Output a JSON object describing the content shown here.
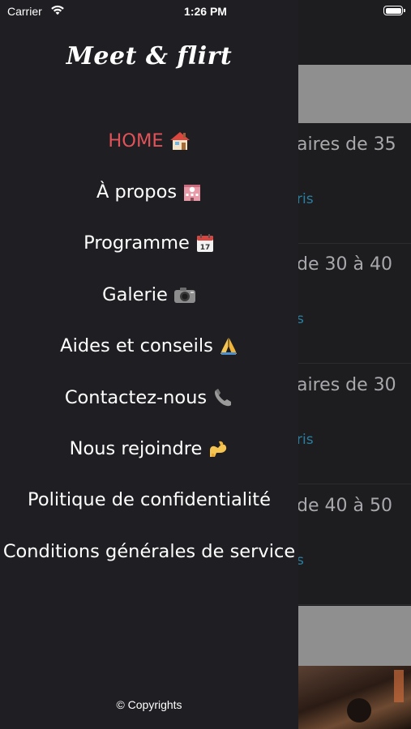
{
  "status_bar": {
    "carrier": "Carrier",
    "time": "1:26 PM"
  },
  "drawer": {
    "brand": "Meet & flirt",
    "menu": [
      {
        "label": "HOME",
        "icon": "house-icon",
        "active": true
      },
      {
        "label": "À propos",
        "icon": "hotel-icon",
        "active": false
      },
      {
        "label": "Programme",
        "icon": "calendar-icon",
        "active": false
      },
      {
        "label": "Galerie",
        "icon": "camera-icon",
        "active": false
      },
      {
        "label": "Aides et conseils",
        "icon": "folded-hands-icon",
        "active": false
      },
      {
        "label": "Contactez-nous",
        "icon": "phone-icon",
        "active": false
      },
      {
        "label": "Nous rejoindre",
        "icon": "flexed-biceps-icon",
        "active": false
      },
      {
        "label": "Politique de confidentialité",
        "icon": null,
        "active": false
      },
      {
        "label": "Conditions générales de service",
        "icon": null,
        "active": false
      }
    ],
    "copyright": "© Copyrights"
  },
  "background": {
    "cards": [
      {
        "title": "aires de 35",
        "link": "ris"
      },
      {
        "title": "de 30 à 40",
        "link": "s"
      },
      {
        "title": "aires de 30",
        "link": "ris"
      },
      {
        "title": "de 40 à 50",
        "link": "s"
      }
    ]
  },
  "colors": {
    "drawer_bg": "#1f1e23",
    "active_item": "#e05358",
    "link": "#2b7fa0"
  }
}
